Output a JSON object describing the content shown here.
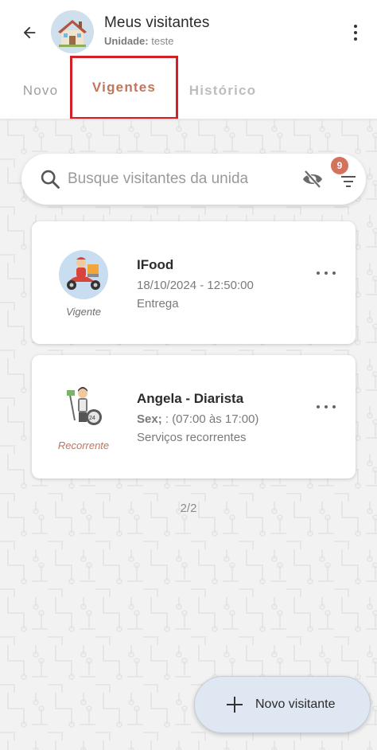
{
  "header": {
    "title": "Meus visitantes",
    "unit_label": "Unidade:",
    "unit_value": "teste"
  },
  "tabs": [
    {
      "label": "Novo"
    },
    {
      "label": "Vigentes",
      "active": true
    },
    {
      "label": "Histórico"
    }
  ],
  "search": {
    "placeholder": "Busque visitantes da unida",
    "filter_count": "9"
  },
  "visitors": [
    {
      "name": "IFood",
      "line2": "18/10/2024 - 12:50:00",
      "line3": "Entrega",
      "status": "Vigente",
      "status_color": "#6d6d6d",
      "icon": "delivery-motorcycle-icon"
    },
    {
      "name": "Angela - Diarista",
      "line2_bold": "Sex;",
      "line2_rest": " : (07:00 às 17:00)",
      "line3": "Serviços recorrentes",
      "status": "Recorrente",
      "status_color": "#c0755c",
      "icon": "cleaning-lady-icon"
    }
  ],
  "pager": "2/2",
  "fab": {
    "label": "Novo visitante"
  },
  "colors": {
    "accent": "#c0755c",
    "highlight_box": "#d32027",
    "badge": "#d4725c",
    "fab_bg": "#dfe7f3"
  }
}
